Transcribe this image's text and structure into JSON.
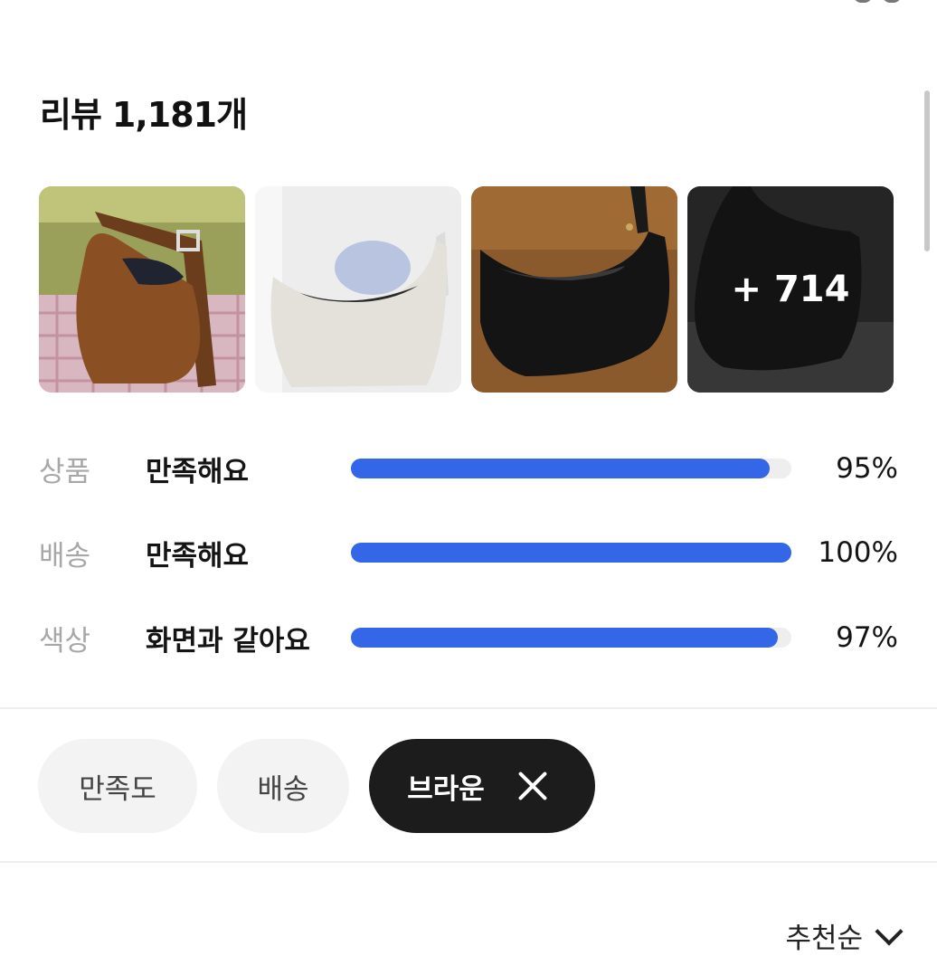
{
  "header": {
    "title": "리뷰",
    "count": "1,181개"
  },
  "photos": [
    {
      "alt_icon": "brown-bag-photo"
    },
    {
      "alt_icon": "white-bag-photo"
    },
    {
      "alt_icon": "black-bag-photo"
    },
    {
      "alt_icon": "dark-bag-photo",
      "more_label": "+ 714"
    }
  ],
  "ratings": [
    {
      "category": "상품",
      "answer": "만족해요",
      "percent_label": "95%",
      "percent": 95
    },
    {
      "category": "배송",
      "answer": "만족해요",
      "percent_label": "100%",
      "percent": 100
    },
    {
      "category": "색상",
      "answer": "화면과 같아요",
      "percent_label": "97%",
      "percent": 97
    }
  ],
  "filters": [
    {
      "label": "만족도",
      "active": false
    },
    {
      "label": "배송",
      "active": false
    },
    {
      "label": "브라운",
      "active": true
    }
  ],
  "sort": {
    "label": "추천순"
  },
  "colors": {
    "bar_fill": "#3367e8",
    "bar_track": "#eeeeee",
    "chip_active": "#1c1c1c",
    "chip_inactive": "#f3f3f3"
  }
}
